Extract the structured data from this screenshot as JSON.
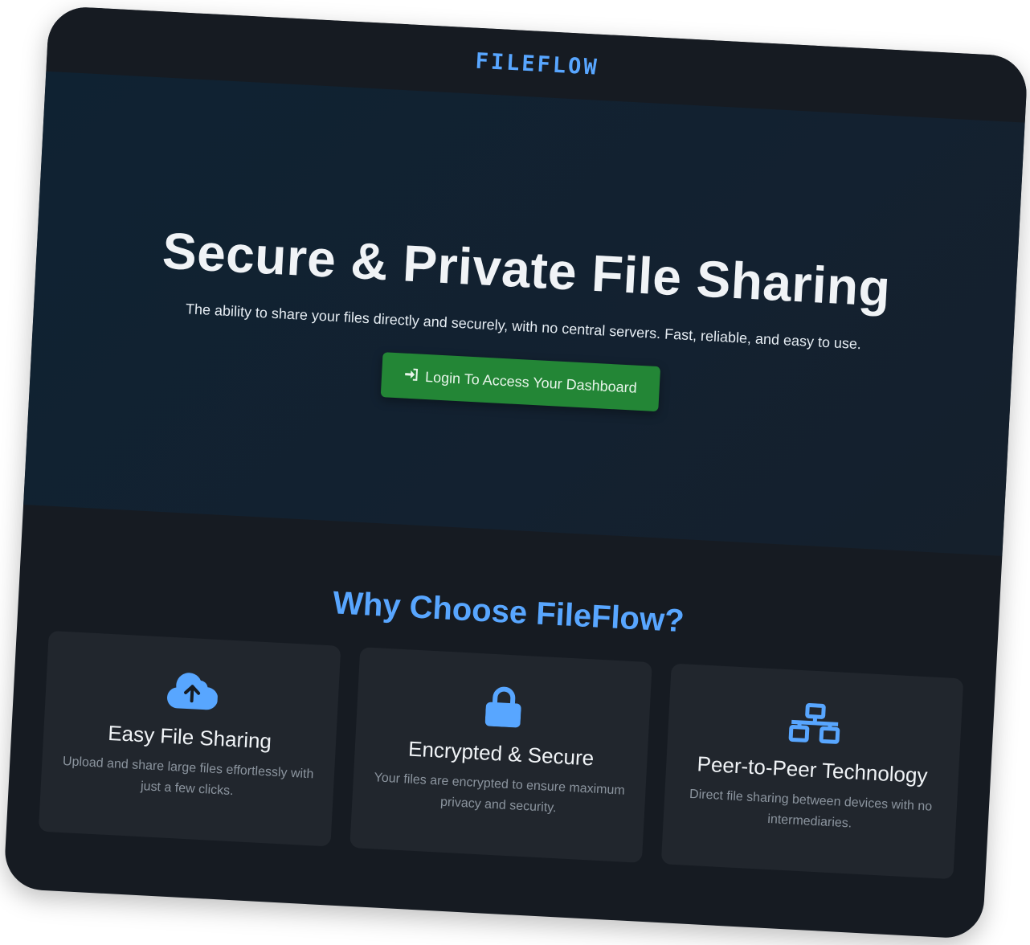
{
  "header": {
    "logo": "FILEFLOW"
  },
  "hero": {
    "title": "Secure & Private File Sharing",
    "subtitle": "The ability to share your files directly and securely, with no central servers. Fast, reliable, and easy to use.",
    "cta_label": "Login To Access Your Dashboard",
    "cta_icon": "sign-in-icon"
  },
  "features": {
    "title": "Why Choose FileFlow?",
    "items": [
      {
        "icon": "cloud-upload-icon",
        "title": "Easy File Sharing",
        "description": "Upload and share large files effortlessly with just a few clicks."
      },
      {
        "icon": "lock-icon",
        "title": "Encrypted & Secure",
        "description": "Your files are encrypted to ensure maximum privacy and security."
      },
      {
        "icon": "network-icon",
        "title": "Peer-to-Peer Technology",
        "description": "Direct file sharing between devices with no intermediaries."
      }
    ]
  },
  "colors": {
    "accent": "#58a6ff",
    "button": "#238636",
    "background": "#161b22",
    "card": "#21262d"
  }
}
